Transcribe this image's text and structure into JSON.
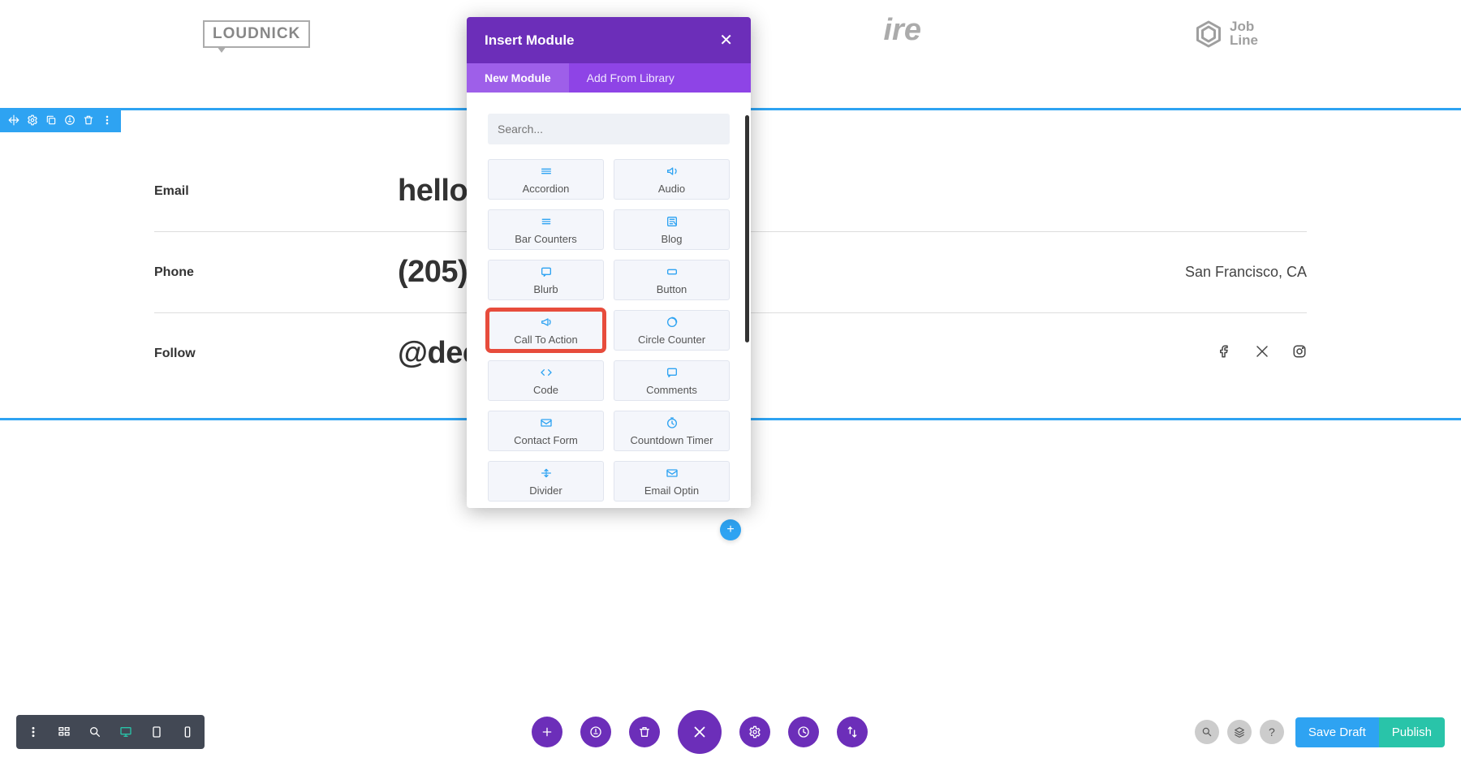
{
  "logos": {
    "loudnick": {
      "a": "LOUD",
      "b": "NICK"
    },
    "jobline": {
      "a": "Job",
      "b": "Line"
    }
  },
  "section": {
    "rows": [
      {
        "label": "Email",
        "value": "hello@",
        "right": ""
      },
      {
        "label": "Phone",
        "value": "(205)",
        "right": "San Francisco, CA"
      },
      {
        "label": "Follow",
        "value": "@dec",
        "right": ""
      }
    ]
  },
  "modal": {
    "title": "Insert Module",
    "tab_new": "New Module",
    "tab_lib": "Add From Library",
    "search_placeholder": "Search...",
    "modules": [
      {
        "name": "Accordion",
        "highlight": false
      },
      {
        "name": "Audio",
        "highlight": false
      },
      {
        "name": "Bar Counters",
        "highlight": false
      },
      {
        "name": "Blog",
        "highlight": false
      },
      {
        "name": "Blurb",
        "highlight": false
      },
      {
        "name": "Button",
        "highlight": false
      },
      {
        "name": "Call To Action",
        "highlight": true
      },
      {
        "name": "Circle Counter",
        "highlight": false
      },
      {
        "name": "Code",
        "highlight": false
      },
      {
        "name": "Comments",
        "highlight": false
      },
      {
        "name": "Contact Form",
        "highlight": false
      },
      {
        "name": "Countdown Timer",
        "highlight": false
      },
      {
        "name": "Divider",
        "highlight": false
      },
      {
        "name": "Email Optin",
        "highlight": false
      }
    ]
  },
  "bottom": {
    "save": "Save Draft",
    "publish": "Publish"
  }
}
